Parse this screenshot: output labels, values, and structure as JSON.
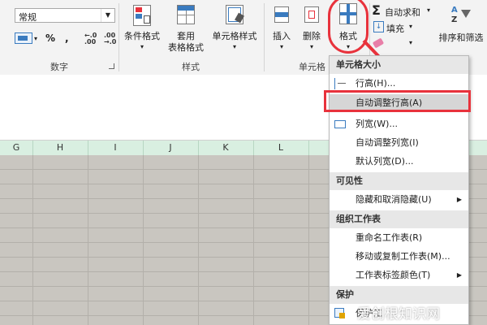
{
  "ribbon": {
    "number_format": "常规",
    "percent_symbol": "%",
    "comma_symbol": ",",
    "dec_increase": "←.0\n.00",
    "dec_decrease": ".00\n→.0",
    "group_number": "数字",
    "cond_format_label": "条件格式",
    "table_format_label1": "套用",
    "table_format_label2": "表格格式",
    "cell_style_label": "单元格样式",
    "group_style": "样式",
    "insert_label": "插入",
    "delete_label": "删除",
    "format_label": "格式",
    "group_cells": "单元格",
    "autosum_label": "自动求和",
    "fill_label": "填充",
    "clear_label": "",
    "sort_filter_label": "排序和筛选"
  },
  "columns": [
    "G",
    "H",
    "I",
    "J",
    "K",
    "L"
  ],
  "menu": {
    "sections": {
      "cell_size": "单元格大小",
      "visibility": "可见性",
      "organize": "组织工作表",
      "protection": "保护"
    },
    "items": {
      "row_height": "行高(H)...",
      "autofit_row": "自动调整行高(A)",
      "col_width": "列宽(W)...",
      "autofit_col": "自动调整列宽(I)",
      "default_width": "默认列宽(D)...",
      "hide_unhide": "隐藏和取消隐藏(U)",
      "rename": "重命名工作表(R)",
      "move_copy": "移动或复制工作表(M)...",
      "tab_color": "工作表标签颜色(T)",
      "protect": "保护工"
    }
  },
  "watermark": "爱创根知识网",
  "colors": {
    "accent_red": "#e8323c",
    "header_green": "#d9efe1"
  }
}
